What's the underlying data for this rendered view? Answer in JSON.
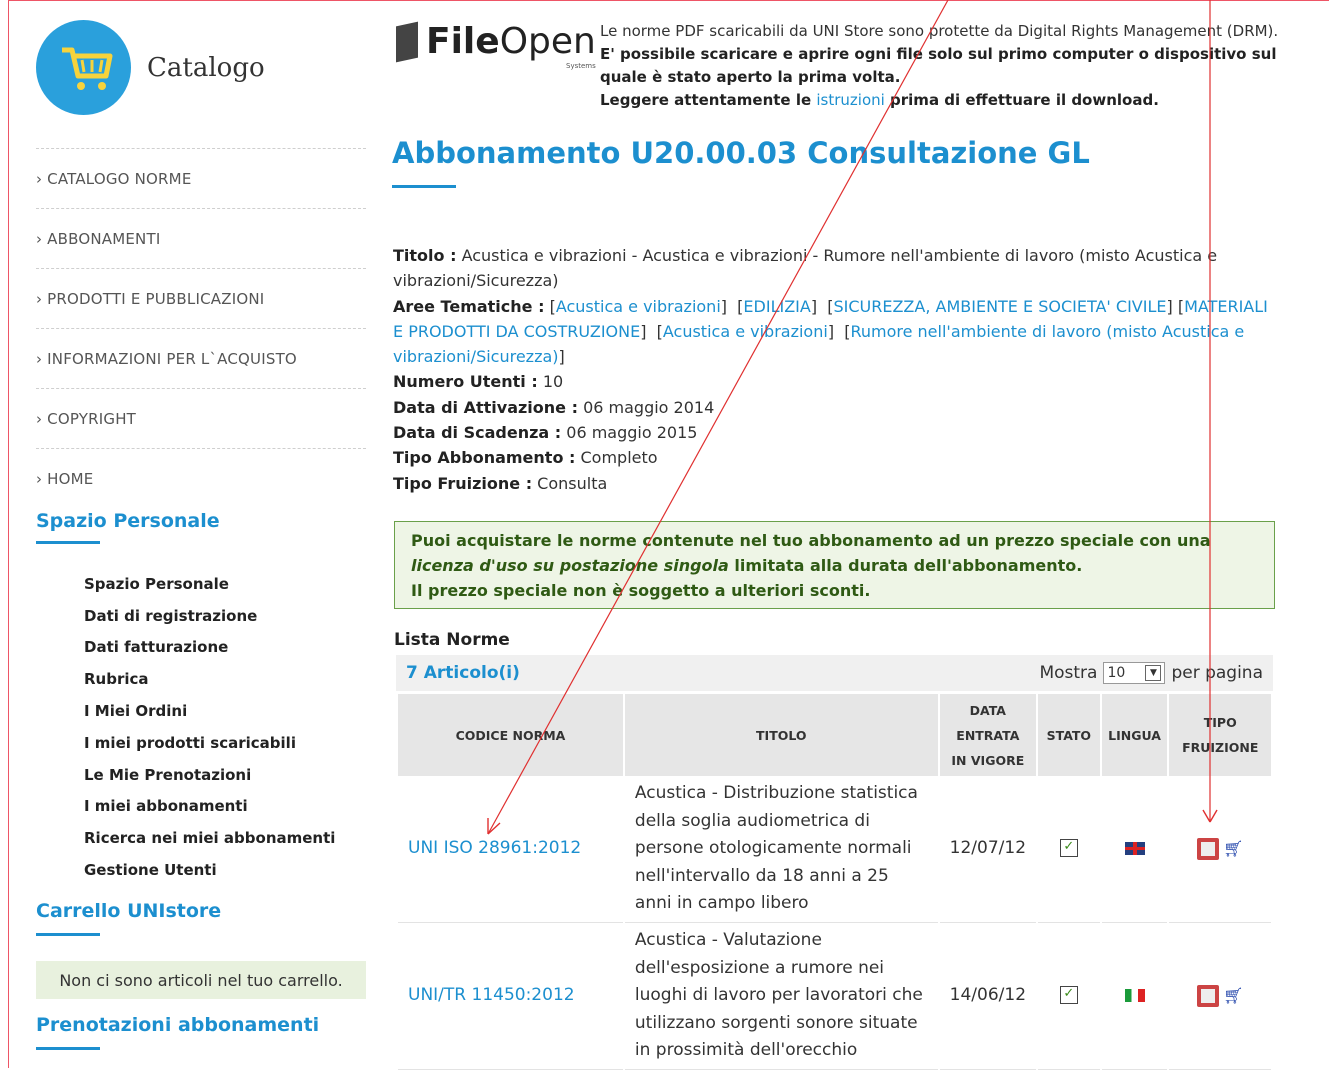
{
  "sidebar": {
    "logo_title": "Catalogo",
    "nav": [
      "› CATALOGO NORME",
      "› ABBONAMENTI",
      "› PRODOTTI E PUBBLICAZIONI",
      "› INFORMAZIONI PER L`ACQUISTO",
      "› COPYRIGHT",
      "› HOME"
    ],
    "spazio_title": "Spazio Personale",
    "spazio_items": [
      "Spazio Personale",
      "Dati di registrazione",
      "Dati fatturazione",
      "Rubrica",
      "I Miei Ordini",
      "I miei prodotti scaricabili",
      "Le Mie Prenotazioni",
      "I miei abbonamenti",
      "Ricerca nei miei abbonamenti",
      "Gestione Utenti"
    ],
    "cart_title": "Carrello UNIstore",
    "cart_empty": "Non ci sono articoli nel tuo carrello.",
    "prenotazioni_title": "Prenotazioni abbonamenti"
  },
  "drm": {
    "logo_file": "File",
    "logo_open": "Open",
    "logo_systems": "Systems",
    "line1": "Le norme PDF scaricabili da UNI Store sono protette da Digital Rights Management (DRM).",
    "line2": "E' possibile scaricare e aprire ogni file solo sul primo computer o dispositivo sul quale è stato aperto la prima volta.",
    "line3_pre": "Leggere attentamente le ",
    "line3_link": "istruzioni",
    "line3_post": " prima di effettuare il download."
  },
  "page_title": "Abbonamento U20.00.03 Consultazione GL",
  "details": {
    "titolo_label": "Titolo :",
    "titolo_value": " Acustica e vibrazioni - Acustica e vibrazioni - Rumore nell'ambiente di lavoro (misto Acustica e vibrazioni/Sicurezza)",
    "aree_label": "Aree Tematiche :",
    "aree": [
      "Acustica e vibrazioni",
      "EDILIZIA",
      "SICUREZZA, AMBIENTE E SOCIETA' CIVILE",
      "MATERIALI E PRODOTTI DA COSTRUZIONE",
      "Acustica e vibrazioni",
      "Rumore nell'ambiente di lavoro (misto Acustica e vibrazioni/Sicurezza)"
    ],
    "utenti_label": "Numero Utenti :",
    "utenti_value": " 10",
    "attivazione_label": "Data di Attivazione :",
    "attivazione_value": " 06 maggio 2014",
    "scadenza_label": "Data di Scadenza :",
    "scadenza_value": " 06 maggio 2015",
    "tipo_abb_label": "Tipo Abbonamento :",
    "tipo_abb_value": " Completo",
    "tipo_fru_label": "Tipo Fruizione :",
    "tipo_fru_value": " Consulta"
  },
  "promo": {
    "line1_pre": "Puoi acquistare le norme contenute nel tuo abbonamento ad un prezzo speciale con una",
    "line2_em": "licenza d'uso su postazione singola",
    "line2_post": " limitata alla durata dell'abbonamento.",
    "line3": "Il prezzo speciale non è soggetto a ulteriori sconti."
  },
  "lista": {
    "title": "Lista Norme",
    "count": "7 Articolo(i)",
    "mostra": "Mostra",
    "per_page_value": "10",
    "per_pagina": "per pagina",
    "headers": {
      "codice": "CODICE NORMA",
      "titolo": "TITOLO",
      "data_1": "DATA",
      "data_2": "ENTRATA",
      "data_3": "IN VIGORE",
      "stato": "STATO",
      "lingua": "LINGUA",
      "tipo_1": "TIPO",
      "tipo_2": "FRUIZIONE"
    },
    "rows": [
      {
        "codice": "UNI ISO 28961:2012",
        "titolo": "Acustica - Distribuzione statistica della soglia audiometrica di persone otologicamente normali nell'intervallo da 18 anni a 25 anni in campo libero",
        "data": "12/07/12",
        "lingua": "uk-flag"
      },
      {
        "codice": "UNI/TR 11450:2012",
        "titolo": "Acustica - Valutazione dell'esposizione a rumore nei luoghi di lavoro per lavoratori che utilizzano sorgenti sonore situate in prossimità dell'orecchio",
        "data": "14/06/12",
        "lingua": "it-flag"
      }
    ]
  },
  "colors": {
    "accent": "#1c8fcf",
    "promo_bg": "#eef5e6",
    "promo_border": "#6aa04a",
    "arrow": "#e03030"
  }
}
